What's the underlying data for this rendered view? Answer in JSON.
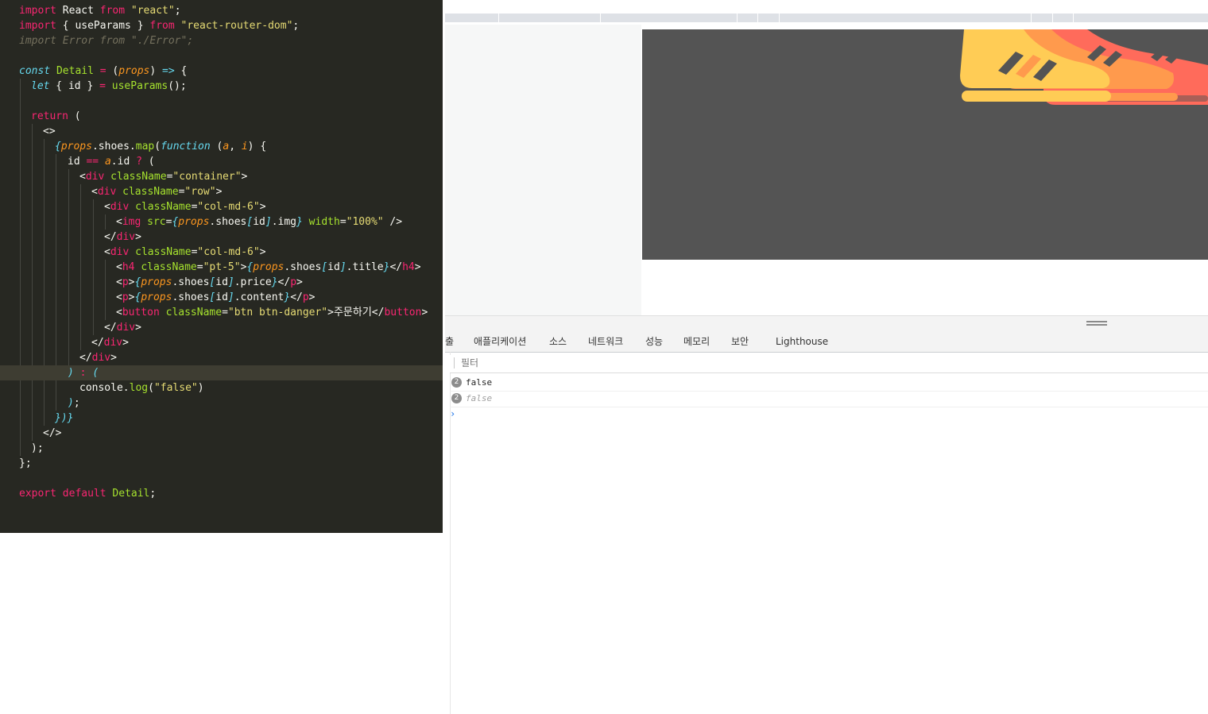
{
  "editor": {
    "theme_colors": {
      "background": "#272822",
      "keyword": "#f92672",
      "string": "#e6db74",
      "function": "#a6e22e",
      "storage": "#66d9ef",
      "param": "#fd971f",
      "plain": "#f8f8f2",
      "dim": "#75715e"
    },
    "lines": [
      {
        "tokens": [
          {
            "t": "import",
            "c": "kw"
          },
          {
            "t": " React ",
            "c": "pl"
          },
          {
            "t": "from",
            "c": "kw"
          },
          {
            "t": " ",
            "c": "pl"
          },
          {
            "t": "\"react\"",
            "c": "str"
          },
          {
            "t": ";",
            "c": "pl"
          }
        ]
      },
      {
        "tokens": [
          {
            "t": "import",
            "c": "kw"
          },
          {
            "t": " { useParams } ",
            "c": "pl"
          },
          {
            "t": "from",
            "c": "kw"
          },
          {
            "t": " ",
            "c": "pl"
          },
          {
            "t": "\"react-router-dom\"",
            "c": "str"
          },
          {
            "t": ";",
            "c": "pl"
          }
        ]
      },
      {
        "tokens": [
          {
            "t": "import Error from \"./Error\";",
            "c": "dim"
          }
        ]
      },
      {
        "tokens": []
      },
      {
        "tokens": [
          {
            "t": "const",
            "c": "st"
          },
          {
            "t": " ",
            "c": "pl"
          },
          {
            "t": "Detail",
            "c": "fn"
          },
          {
            "t": " = ",
            "c": "kw"
          },
          {
            "t": "(",
            "c": "pl"
          },
          {
            "t": "props",
            "c": "par"
          },
          {
            "t": ") ",
            "c": "pl"
          },
          {
            "t": "=>",
            "c": "st"
          },
          {
            "t": " {",
            "c": "pl"
          }
        ]
      },
      {
        "tokens": [
          {
            "t": "let",
            "c": "st"
          },
          {
            "t": " { id } ",
            "c": "pl"
          },
          {
            "t": "=",
            "c": "kw"
          },
          {
            "t": " ",
            "c": "pl"
          },
          {
            "t": "useParams",
            "c": "fn"
          },
          {
            "t": "();",
            "c": "pl"
          }
        ]
      },
      {
        "tokens": []
      },
      {
        "tokens": [
          {
            "t": "return",
            "c": "kw"
          },
          {
            "t": " (",
            "c": "pl"
          }
        ]
      },
      {
        "tokens": [
          {
            "t": "<>",
            "c": "pl"
          }
        ]
      },
      {
        "tokens": [
          {
            "t": "{",
            "c": "st"
          },
          {
            "t": "props",
            "c": "par"
          },
          {
            "t": ".shoes.",
            "c": "pl"
          },
          {
            "t": "map",
            "c": "fn"
          },
          {
            "t": "(",
            "c": "pl"
          },
          {
            "t": "function",
            "c": "st"
          },
          {
            "t": " (",
            "c": "pl"
          },
          {
            "t": "a",
            "c": "par"
          },
          {
            "t": ", ",
            "c": "pl"
          },
          {
            "t": "i",
            "c": "par"
          },
          {
            "t": ") {",
            "c": "pl"
          }
        ]
      },
      {
        "tokens": [
          {
            "t": "id ",
            "c": "pl"
          },
          {
            "t": "==",
            "c": "kw"
          },
          {
            "t": " ",
            "c": "pl"
          },
          {
            "t": "a",
            "c": "par"
          },
          {
            "t": ".id ",
            "c": "pl"
          },
          {
            "t": "?",
            "c": "kw"
          },
          {
            "t": " (",
            "c": "pl"
          }
        ]
      },
      {
        "tokens": [
          {
            "t": "<",
            "c": "pl"
          },
          {
            "t": "div",
            "c": "kw"
          },
          {
            "t": " ",
            "c": "pl"
          },
          {
            "t": "className",
            "c": "fn"
          },
          {
            "t": "=",
            "c": "pl"
          },
          {
            "t": "\"container\"",
            "c": "str"
          },
          {
            "t": ">",
            "c": "pl"
          }
        ]
      },
      {
        "tokens": [
          {
            "t": "<",
            "c": "pl"
          },
          {
            "t": "div",
            "c": "kw"
          },
          {
            "t": " ",
            "c": "pl"
          },
          {
            "t": "className",
            "c": "fn"
          },
          {
            "t": "=",
            "c": "pl"
          },
          {
            "t": "\"row\"",
            "c": "str"
          },
          {
            "t": ">",
            "c": "pl"
          }
        ]
      },
      {
        "tokens": [
          {
            "t": "<",
            "c": "pl"
          },
          {
            "t": "div",
            "c": "kw"
          },
          {
            "t": " ",
            "c": "pl"
          },
          {
            "t": "className",
            "c": "fn"
          },
          {
            "t": "=",
            "c": "pl"
          },
          {
            "t": "\"col-md-6\"",
            "c": "str"
          },
          {
            "t": ">",
            "c": "pl"
          }
        ]
      },
      {
        "tokens": [
          {
            "t": "<",
            "c": "pl"
          },
          {
            "t": "img",
            "c": "kw"
          },
          {
            "t": " ",
            "c": "pl"
          },
          {
            "t": "src",
            "c": "fn"
          },
          {
            "t": "=",
            "c": "pl"
          },
          {
            "t": "{",
            "c": "st"
          },
          {
            "t": "props",
            "c": "par"
          },
          {
            "t": ".shoes",
            "c": "pl"
          },
          {
            "t": "[",
            "c": "st"
          },
          {
            "t": "id",
            "c": "pl"
          },
          {
            "t": "]",
            "c": "st"
          },
          {
            "t": ".img",
            "c": "pl"
          },
          {
            "t": "}",
            "c": "st"
          },
          {
            "t": " ",
            "c": "pl"
          },
          {
            "t": "width",
            "c": "fn"
          },
          {
            "t": "=",
            "c": "pl"
          },
          {
            "t": "\"100%\"",
            "c": "str"
          },
          {
            "t": " />",
            "c": "pl"
          }
        ]
      },
      {
        "tokens": [
          {
            "t": "</",
            "c": "pl"
          },
          {
            "t": "div",
            "c": "kw"
          },
          {
            "t": ">",
            "c": "pl"
          }
        ]
      },
      {
        "tokens": [
          {
            "t": "<",
            "c": "pl"
          },
          {
            "t": "div",
            "c": "kw"
          },
          {
            "t": " ",
            "c": "pl"
          },
          {
            "t": "className",
            "c": "fn"
          },
          {
            "t": "=",
            "c": "pl"
          },
          {
            "t": "\"col-md-6\"",
            "c": "str"
          },
          {
            "t": ">",
            "c": "pl"
          }
        ]
      },
      {
        "tokens": [
          {
            "t": "<",
            "c": "pl"
          },
          {
            "t": "h4",
            "c": "kw"
          },
          {
            "t": " ",
            "c": "pl"
          },
          {
            "t": "className",
            "c": "fn"
          },
          {
            "t": "=",
            "c": "pl"
          },
          {
            "t": "\"pt-5\"",
            "c": "str"
          },
          {
            "t": ">",
            "c": "pl"
          },
          {
            "t": "{",
            "c": "st"
          },
          {
            "t": "props",
            "c": "par"
          },
          {
            "t": ".shoes",
            "c": "pl"
          },
          {
            "t": "[",
            "c": "st"
          },
          {
            "t": "id",
            "c": "pl"
          },
          {
            "t": "]",
            "c": "st"
          },
          {
            "t": ".title",
            "c": "pl"
          },
          {
            "t": "}",
            "c": "st"
          },
          {
            "t": "</",
            "c": "pl"
          },
          {
            "t": "h4",
            "c": "kw"
          },
          {
            "t": ">",
            "c": "pl"
          }
        ]
      },
      {
        "tokens": [
          {
            "t": "<",
            "c": "pl"
          },
          {
            "t": "p",
            "c": "kw"
          },
          {
            "t": ">",
            "c": "pl"
          },
          {
            "t": "{",
            "c": "st"
          },
          {
            "t": "props",
            "c": "par"
          },
          {
            "t": ".shoes",
            "c": "pl"
          },
          {
            "t": "[",
            "c": "st"
          },
          {
            "t": "id",
            "c": "pl"
          },
          {
            "t": "]",
            "c": "st"
          },
          {
            "t": ".price",
            "c": "pl"
          },
          {
            "t": "}",
            "c": "st"
          },
          {
            "t": "</",
            "c": "pl"
          },
          {
            "t": "p",
            "c": "kw"
          },
          {
            "t": ">",
            "c": "pl"
          }
        ]
      },
      {
        "tokens": [
          {
            "t": "<",
            "c": "pl"
          },
          {
            "t": "p",
            "c": "kw"
          },
          {
            "t": ">",
            "c": "pl"
          },
          {
            "t": "{",
            "c": "st"
          },
          {
            "t": "props",
            "c": "par"
          },
          {
            "t": ".shoes",
            "c": "pl"
          },
          {
            "t": "[",
            "c": "st"
          },
          {
            "t": "id",
            "c": "pl"
          },
          {
            "t": "]",
            "c": "st"
          },
          {
            "t": ".content",
            "c": "pl"
          },
          {
            "t": "}",
            "c": "st"
          },
          {
            "t": "</",
            "c": "pl"
          },
          {
            "t": "p",
            "c": "kw"
          },
          {
            "t": ">",
            "c": "pl"
          }
        ]
      },
      {
        "tokens": [
          {
            "t": "<",
            "c": "pl"
          },
          {
            "t": "button",
            "c": "kw"
          },
          {
            "t": " ",
            "c": "pl"
          },
          {
            "t": "className",
            "c": "fn"
          },
          {
            "t": "=",
            "c": "pl"
          },
          {
            "t": "\"btn btn-danger\"",
            "c": "str"
          },
          {
            "t": ">주문하기</",
            "c": "pl"
          },
          {
            "t": "button",
            "c": "kw"
          },
          {
            "t": ">",
            "c": "pl"
          }
        ]
      },
      {
        "tokens": [
          {
            "t": "</",
            "c": "pl"
          },
          {
            "t": "div",
            "c": "kw"
          },
          {
            "t": ">",
            "c": "pl"
          }
        ]
      },
      {
        "tokens": [
          {
            "t": "</",
            "c": "pl"
          },
          {
            "t": "div",
            "c": "kw"
          },
          {
            "t": ">",
            "c": "pl"
          }
        ]
      },
      {
        "tokens": [
          {
            "t": "</",
            "c": "pl"
          },
          {
            "t": "div",
            "c": "kw"
          },
          {
            "t": ">",
            "c": "pl"
          }
        ]
      },
      {
        "tokens": [
          {
            "t": ")",
            "c": "st"
          },
          {
            "t": " ",
            "c": "pl"
          },
          {
            "t": ":",
            "c": "kw"
          },
          {
            "t": " ",
            "c": "pl"
          },
          {
            "t": "(",
            "c": "st"
          }
        ]
      },
      {
        "tokens": [
          {
            "t": "console",
            "c": "pl"
          },
          {
            "t": ".",
            "c": "pl"
          },
          {
            "t": "log",
            "c": "fn"
          },
          {
            "t": "(",
            "c": "pl"
          },
          {
            "t": "\"false\"",
            "c": "str"
          },
          {
            "t": ")",
            "c": "pl"
          }
        ]
      },
      {
        "tokens": [
          {
            "t": ")",
            "c": "st"
          },
          {
            "t": ";",
            "c": "pl"
          }
        ]
      },
      {
        "tokens": [
          {
            "t": "})",
            "c": "st"
          },
          {
            "t": "}",
            "c": "st"
          }
        ]
      },
      {
        "tokens": [
          {
            "t": "</>",
            "c": "pl"
          }
        ]
      },
      {
        "tokens": [
          {
            "t": ");",
            "c": "pl"
          }
        ]
      },
      {
        "tokens": [
          {
            "t": "};",
            "c": "pl"
          }
        ]
      },
      {
        "tokens": []
      },
      {
        "tokens": [
          {
            "t": "export",
            "c": "kw"
          },
          {
            "t": " ",
            "c": "pl"
          },
          {
            "t": "default",
            "c": "kw"
          },
          {
            "t": " ",
            "c": "pl"
          },
          {
            "t": "Detail",
            "c": "fn"
          },
          {
            "t": ";",
            "c": "pl"
          }
        ]
      }
    ]
  },
  "browser": {
    "banner_image": "sneakers-banner-icon",
    "banner_colors": {
      "background": "#545454",
      "shoe_front": "#ffcc55",
      "shoe_mid": "#ff9a4d",
      "shoe_back": "#ff6b5b"
    }
  },
  "devtools": {
    "tabs": [
      "출",
      "애플리케이션",
      "소스",
      "네트워크",
      "성능",
      "메모리",
      "보안",
      "Lighthouse"
    ],
    "filter_placeholder": "필터",
    "messages": [
      {
        "count": "2",
        "text": "false"
      },
      {
        "count": "2",
        "text": "false"
      }
    ],
    "prompt_icon": "chevron-right-icon"
  }
}
